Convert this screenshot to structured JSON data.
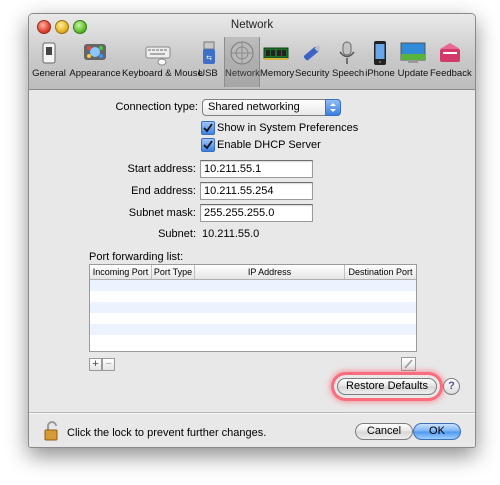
{
  "window": {
    "title": "Network"
  },
  "toolbar": {
    "items": [
      {
        "label": "General",
        "icon": "general-switch-icon"
      },
      {
        "label": "Appearance",
        "icon": "appearance-icon"
      },
      {
        "label": "Keyboard & Mouse",
        "icon": "keyboard-icon"
      },
      {
        "label": "USB",
        "icon": "usb-icon"
      },
      {
        "label": "Network",
        "icon": "network-icon",
        "selected": true
      },
      {
        "label": "Memory",
        "icon": "memory-chip-icon"
      },
      {
        "label": "Security",
        "icon": "security-key-icon"
      },
      {
        "label": "Speech",
        "icon": "microphone-icon"
      },
      {
        "label": "iPhone",
        "icon": "iphone-icon"
      },
      {
        "label": "Update",
        "icon": "update-icon"
      },
      {
        "label": "Feedback",
        "icon": "feedback-icon"
      }
    ]
  },
  "form": {
    "connection_type_label": "Connection type:",
    "connection_type_value": "Shared networking",
    "show_in_prefs_label": "Show in System Preferences",
    "show_in_prefs_checked": true,
    "enable_dhcp_label": "Enable DHCP Server",
    "enable_dhcp_checked": true,
    "start_address_label": "Start address:",
    "start_address_value": "10.211.55.1",
    "end_address_label": "End address:",
    "end_address_value": "10.211.55.254",
    "subnet_mask_label": "Subnet mask:",
    "subnet_mask_value": "255.255.255.0",
    "subnet_label": "Subnet:",
    "subnet_value": "10.211.55.0"
  },
  "port_forwarding": {
    "title": "Port forwarding list:",
    "columns": [
      "Incoming Port",
      "Port Type",
      "IP Address",
      "Destination Port"
    ],
    "rows": [],
    "add_label": "+",
    "remove_label": "−"
  },
  "buttons": {
    "restore_defaults": "Restore Defaults",
    "help": "?",
    "cancel": "Cancel",
    "ok": "OK"
  },
  "lock": {
    "text": "Click the lock to prevent further changes."
  },
  "colors": {
    "accent": "#3d82e3",
    "highlight": "#ff4a60"
  }
}
